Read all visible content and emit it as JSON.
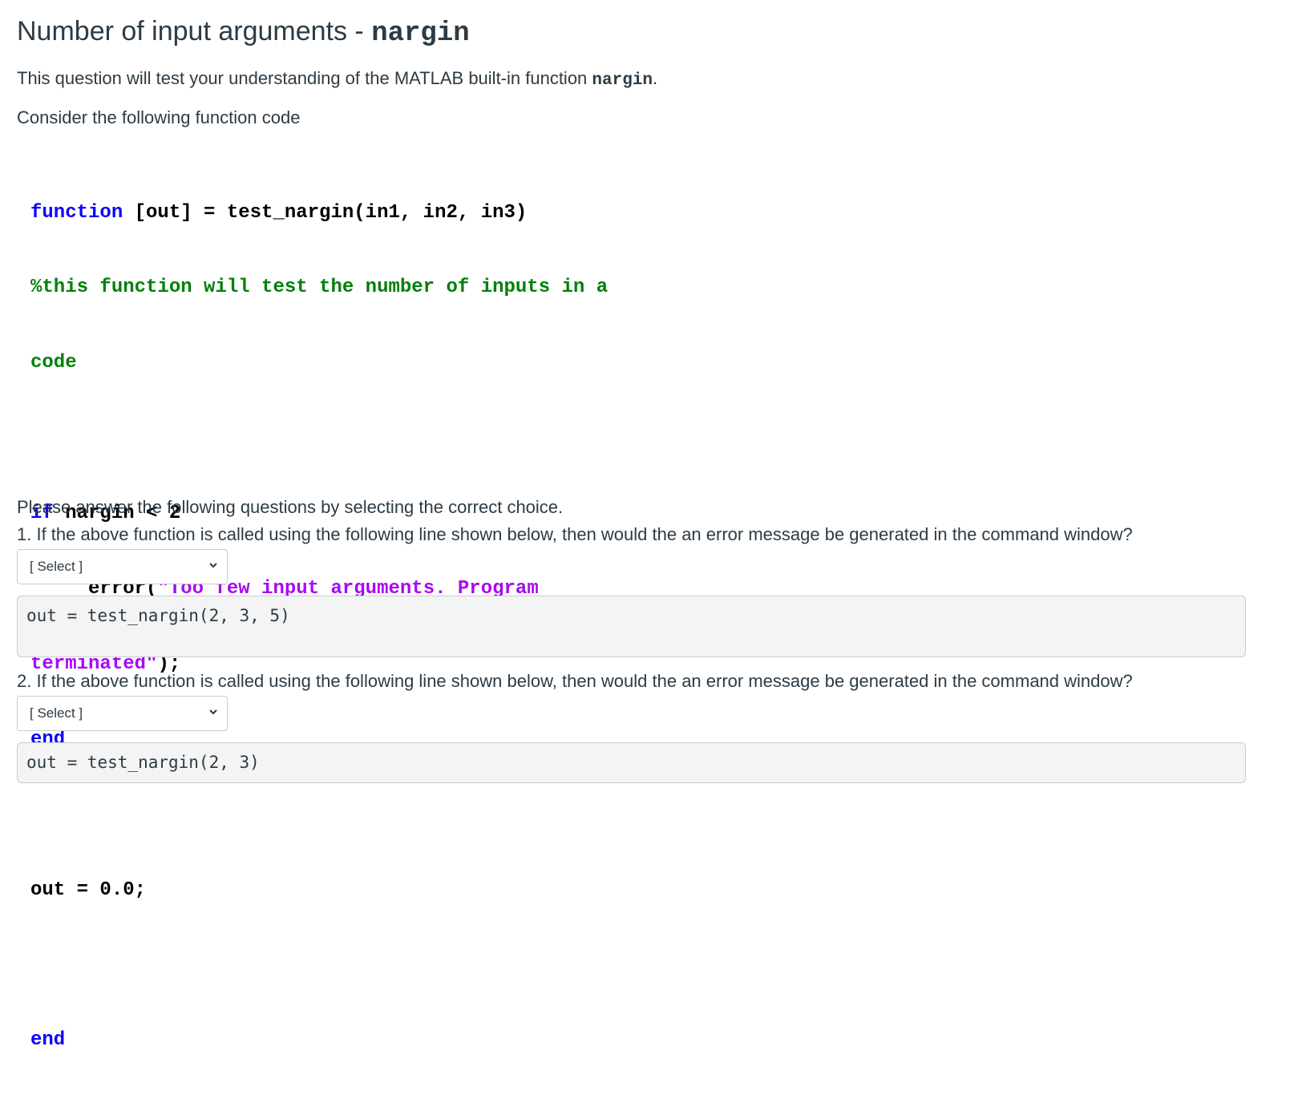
{
  "title": {
    "text": "Number of input arguments - ",
    "code": "nargin"
  },
  "intro": {
    "text": "This question will test your understanding of the MATLAB built-in function ",
    "code": "nargin",
    "suffix": "."
  },
  "consider": "Consider the following function code",
  "matlab_code": {
    "line1_kw": "function",
    "line1_rest": " [out] = test_nargin(in1, in2, in3)",
    "line2_comment": "%this function will test the number of inputs in a",
    "line3_comment": "code",
    "line5_kw": "if",
    "line5_rest": " nargin < 2",
    "line6_indent": "     error(",
    "line6_string": "\"Too few input arguments. Program",
    "line7_string": "terminated\"",
    "line7_rest": ");",
    "line8_kw": "end",
    "line10": "out = 0.0;",
    "line12_kw": "end"
  },
  "colors": {
    "keyword": "#0e00ff",
    "comment": "#028009",
    "string": "#a709f5",
    "text": "#2d3b45",
    "code_bg": "#f4f4f4"
  },
  "instructions": "Please answer the following questions by selecting the correct choice.",
  "questions": [
    {
      "text": "1. If the above function is called using the following line shown below, then would the an error message be generated in the command window?",
      "select_value": "[ Select ]",
      "code": "out = test_nargin(2, 3, 5)"
    },
    {
      "text": "2. If the above function is called using the following line shown below, then would the an error message be generated in the command window?",
      "select_value": "[ Select ]",
      "code": "out = test_nargin(2, 3)"
    }
  ]
}
